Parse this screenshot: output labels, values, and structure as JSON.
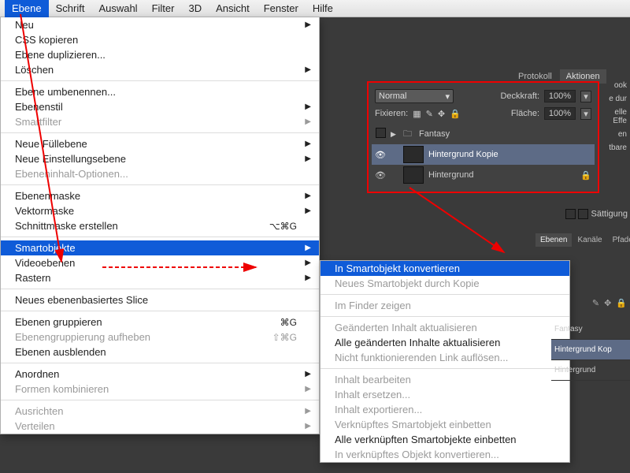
{
  "menubar": {
    "items": [
      "Ebene",
      "Schrift",
      "Auswahl",
      "Filter",
      "3D",
      "Ansicht",
      "Fenster",
      "Hilfe"
    ],
    "active_index": 0
  },
  "dropdown": {
    "groups": [
      [
        {
          "label": "Neu",
          "arrow": true
        },
        {
          "label": "CSS kopieren"
        },
        {
          "label": "Ebene duplizieren..."
        },
        {
          "label": "Löschen",
          "arrow": true
        }
      ],
      [
        {
          "label": "Ebene umbenennen..."
        },
        {
          "label": "Ebenenstil",
          "arrow": true
        },
        {
          "label": "Smartfilter",
          "arrow": true,
          "disabled": true
        }
      ],
      [
        {
          "label": "Neue Füllebene",
          "arrow": true
        },
        {
          "label": "Neue Einstellungsebene",
          "arrow": true
        },
        {
          "label": "Ebeneninhalt-Optionen...",
          "disabled": true
        }
      ],
      [
        {
          "label": "Ebenenmaske",
          "arrow": true
        },
        {
          "label": "Vektormaske",
          "arrow": true
        },
        {
          "label": "Schnittmaske erstellen",
          "shortcut": "⌥⌘G"
        }
      ],
      [
        {
          "label": "Smartobjekte",
          "arrow": true,
          "highlight": true
        },
        {
          "label": "Videoebenen",
          "arrow": true
        },
        {
          "label": "Rastern",
          "arrow": true
        }
      ],
      [
        {
          "label": "Neues ebenenbasiertes Slice"
        }
      ],
      [
        {
          "label": "Ebenen gruppieren",
          "shortcut": "⌘G"
        },
        {
          "label": "Ebenengruppierung aufheben",
          "shortcut": "⇧⌘G",
          "disabled": true
        },
        {
          "label": "Ebenen ausblenden"
        }
      ],
      [
        {
          "label": "Anordnen",
          "arrow": true
        },
        {
          "label": "Formen kombinieren",
          "arrow": true,
          "disabled": true
        }
      ],
      [
        {
          "label": "Ausrichten",
          "arrow": true,
          "disabled": true
        },
        {
          "label": "Verteilen",
          "arrow": true,
          "disabled": true
        }
      ]
    ]
  },
  "submenu": {
    "groups": [
      [
        {
          "label": "In Smartobjekt konvertieren",
          "highlight": true
        },
        {
          "label": "Neues Smartobjekt durch Kopie",
          "disabled": true
        }
      ],
      [
        {
          "label": "Im Finder zeigen",
          "disabled": true
        }
      ],
      [
        {
          "label": "Geänderten Inhalt aktualisieren",
          "disabled": true
        },
        {
          "label": "Alle geänderten Inhalte aktualisieren"
        },
        {
          "label": "Nicht funktionierenden Link auflösen...",
          "disabled": true
        }
      ],
      [
        {
          "label": "Inhalt bearbeiten",
          "disabled": true
        },
        {
          "label": "Inhalt ersetzen...",
          "disabled": true
        },
        {
          "label": "Inhalt exportieren...",
          "disabled": true
        },
        {
          "label": "Verknüpftes Smartobjekt einbetten",
          "disabled": true
        },
        {
          "label": "Alle verknüpften Smartobjekte einbetten"
        },
        {
          "label": "In verknüpftes Objekt konvertieren...",
          "disabled": true
        }
      ]
    ]
  },
  "panel_tabs": {
    "items": [
      "Protokoll",
      "Aktionen"
    ],
    "active": "Aktionen"
  },
  "layers_panel": {
    "blend_mode": "Normal",
    "opacity_label": "Deckkraft:",
    "opacity": "100%",
    "lock_label": "Fixieren:",
    "fill_label": "Fläche:",
    "fill": "100%",
    "items": [
      {
        "type": "group",
        "name": "Fantasy",
        "expanded": false
      },
      {
        "type": "layer",
        "name": "Hintergrund Kopie",
        "active": true
      },
      {
        "type": "layer",
        "name": "Hintergrund",
        "locked": true
      }
    ]
  },
  "right_hints": [
    "ook",
    "e dur",
    "elle Effe",
    "en",
    "tbare"
  ],
  "saturation_label": "Sättigung",
  "tabs2": {
    "items": [
      "Ebenen",
      "Kanäle",
      "Pfade"
    ],
    "active": "Ebenen"
  },
  "right_layers": [
    "Fantasy",
    "Hintergrund Kop",
    "Hintergrund"
  ]
}
